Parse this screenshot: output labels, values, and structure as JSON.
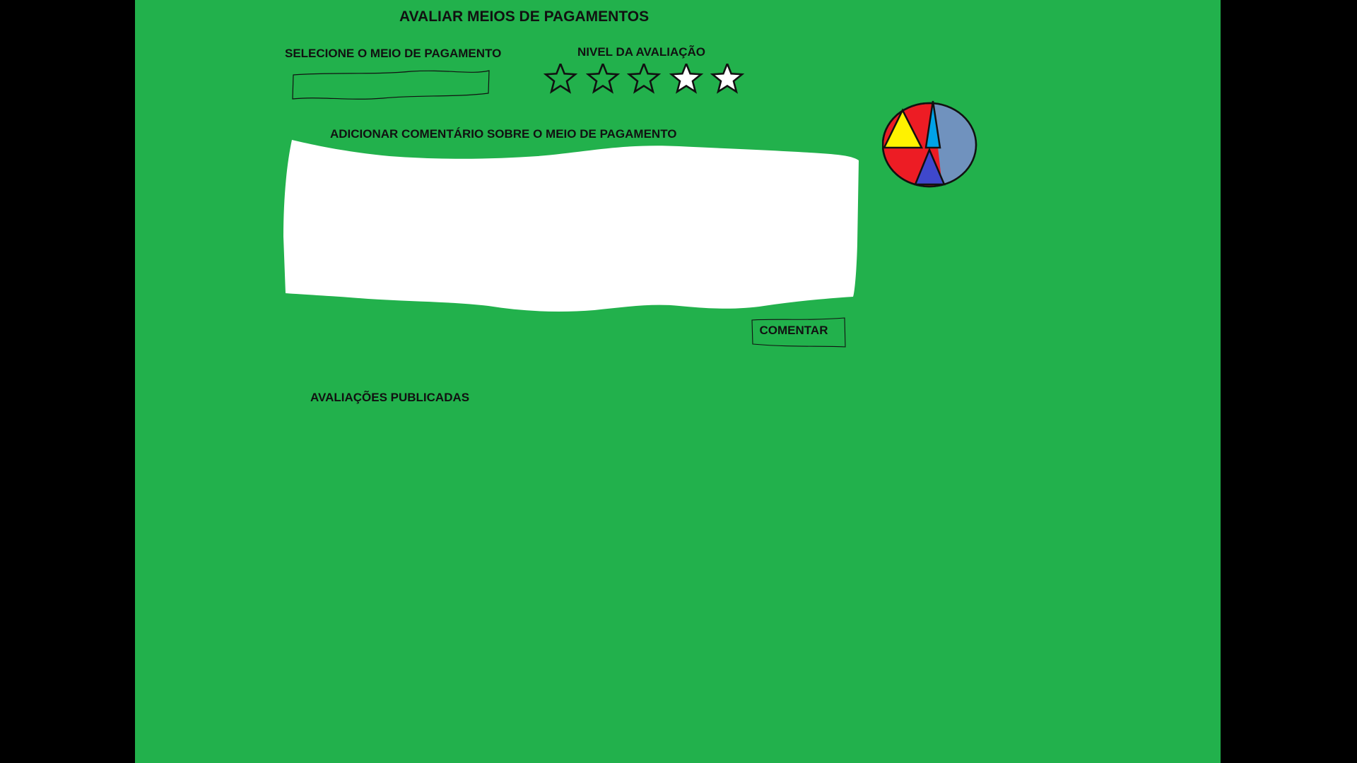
{
  "page": {
    "title": "AVALIAR MEIOS DE PAGAMENTOS",
    "background_color": "#22b14c",
    "frame_color": "#000000"
  },
  "payment_method": {
    "label": "SELECIONE O MEIO DE PAGAMENTO",
    "selected_value": ""
  },
  "rating": {
    "label": "NIVEL DA AVALIAÇÃO",
    "max_stars": 5,
    "filled_stars": 2,
    "star_colors": [
      "#22b14c",
      "#22b14c",
      "#22b14c",
      "#ffffff",
      "#ffffff"
    ]
  },
  "comment": {
    "label": "ADICIONAR COMENTÁRIO SOBRE O MEIO DE PAGAMENTO",
    "value": "",
    "button_label": "COMENTAR"
  },
  "published": {
    "label": "AVALIAÇÕES PUBLICADAS"
  },
  "logo": {
    "icon": "pie-logo-icon",
    "colors": [
      "#ed1c24",
      "#fff200",
      "#00a2e8",
      "#7092be",
      "#3f48cc"
    ]
  }
}
